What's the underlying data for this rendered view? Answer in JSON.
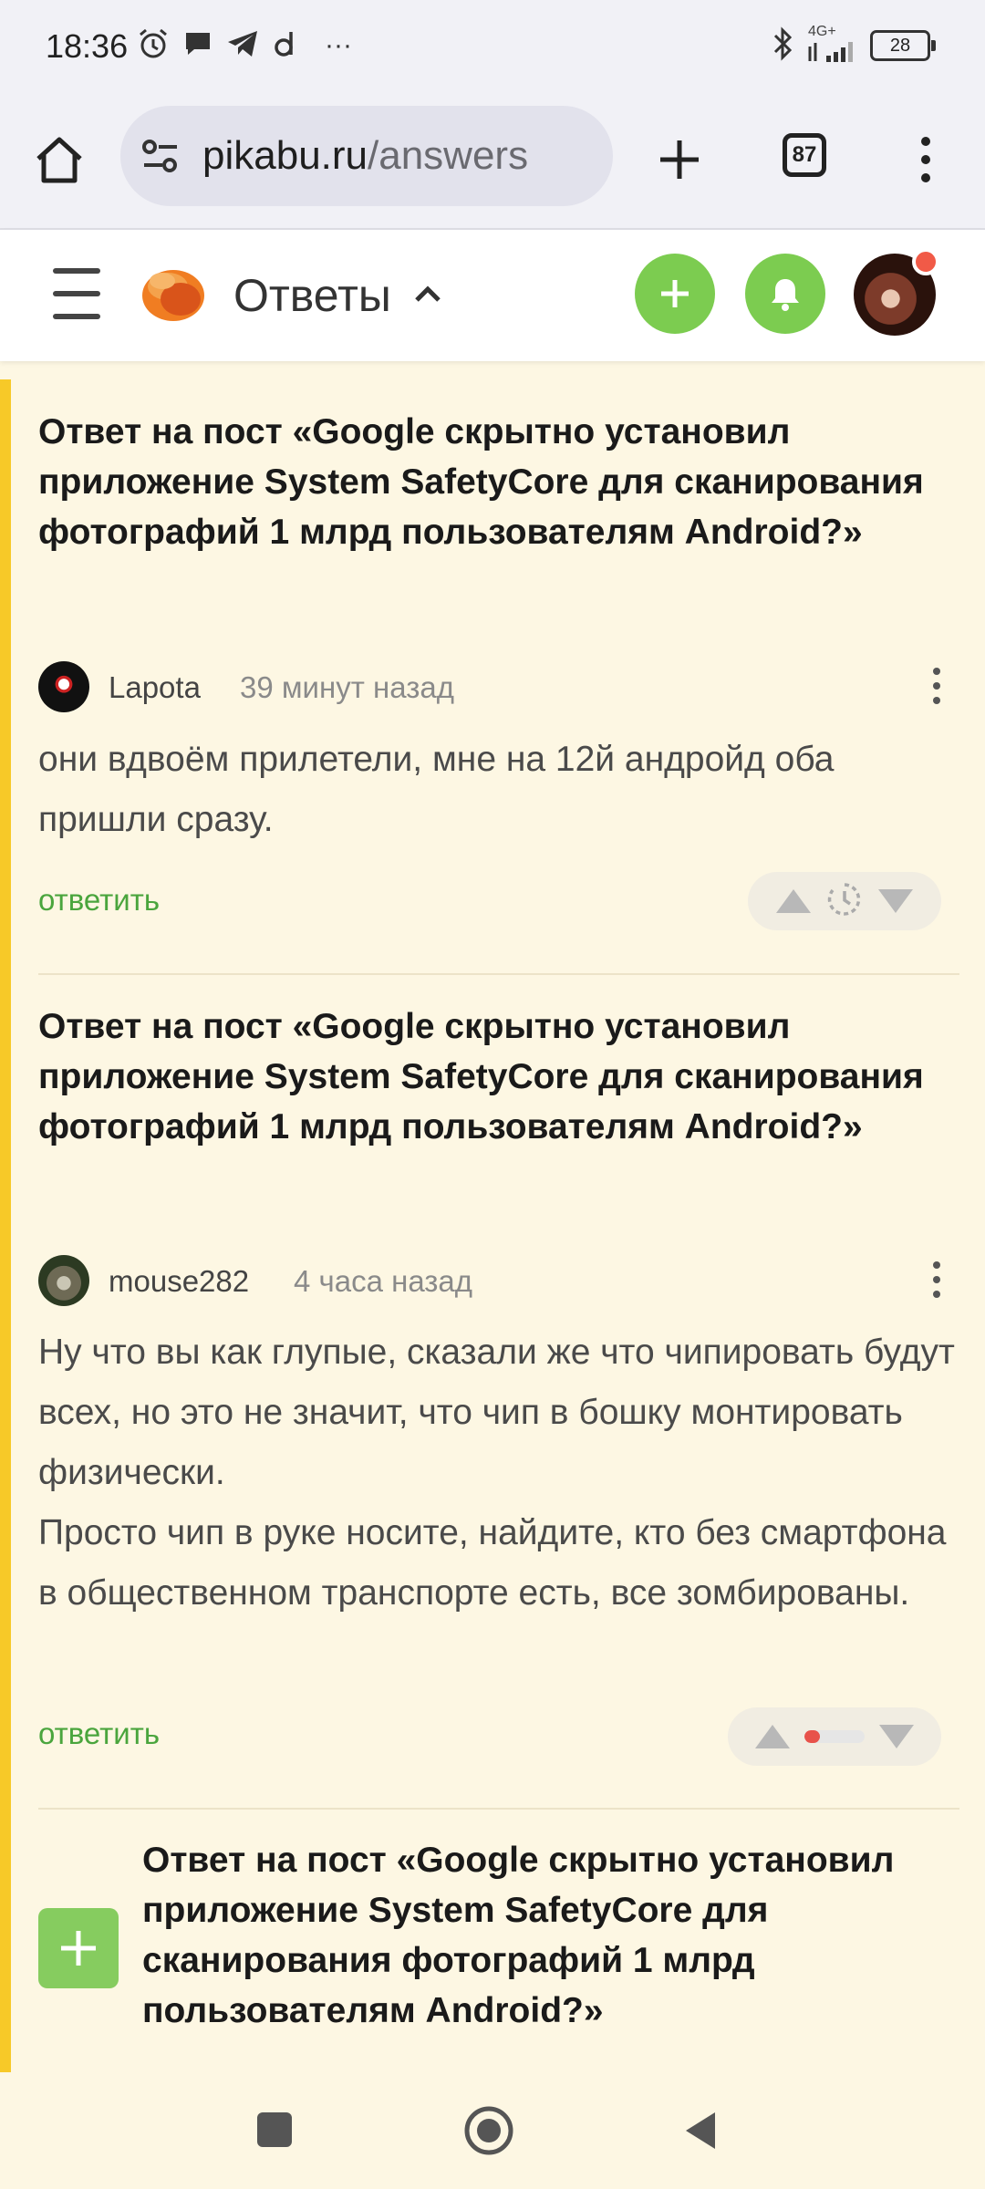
{
  "status_bar": {
    "time": "18:36",
    "network": "4G+",
    "battery": "28",
    "more": "···"
  },
  "browser": {
    "url_domain": "pikabu.ru",
    "url_path": "/answers",
    "tab_count": "87"
  },
  "header": {
    "section": "Ответы",
    "accent_color": "#7ccc50"
  },
  "posts": [
    {
      "title": "Ответ на пост «Google скрытно установил приложение System SafetyCore для сканирования фотографий 1 млрд пользователям Android?»",
      "author": "Lapota",
      "time": "39 минут назад",
      "comment": "они вдвоём прилетели, мне на 12й андройд оба пришли сразу.",
      "reply": "ответить",
      "rating_state": "pending-clock"
    },
    {
      "title": "Ответ на пост «Google скрытно установил приложение System SafetyCore для сканирования фотографий 1 млрд пользователям Android?»",
      "author": "mouse282",
      "time": "4 часа назад",
      "comment": "Ну что вы как глупые, сказали же что чипировать будут всех, но это не значит, что чип в бошку монтировать физически.\nПросто чип в руке носите, найдите, кто без смартфона в общественном транспорте есть, все зомбированы.",
      "reply": "ответить",
      "rating_state": "bar",
      "rating_fraction": 0.25
    },
    {
      "title": "Ответ на пост «Google скрытно установил приложение System SafetyCore для сканирования фотографий 1 млрд пользователям Android?»"
    }
  ]
}
